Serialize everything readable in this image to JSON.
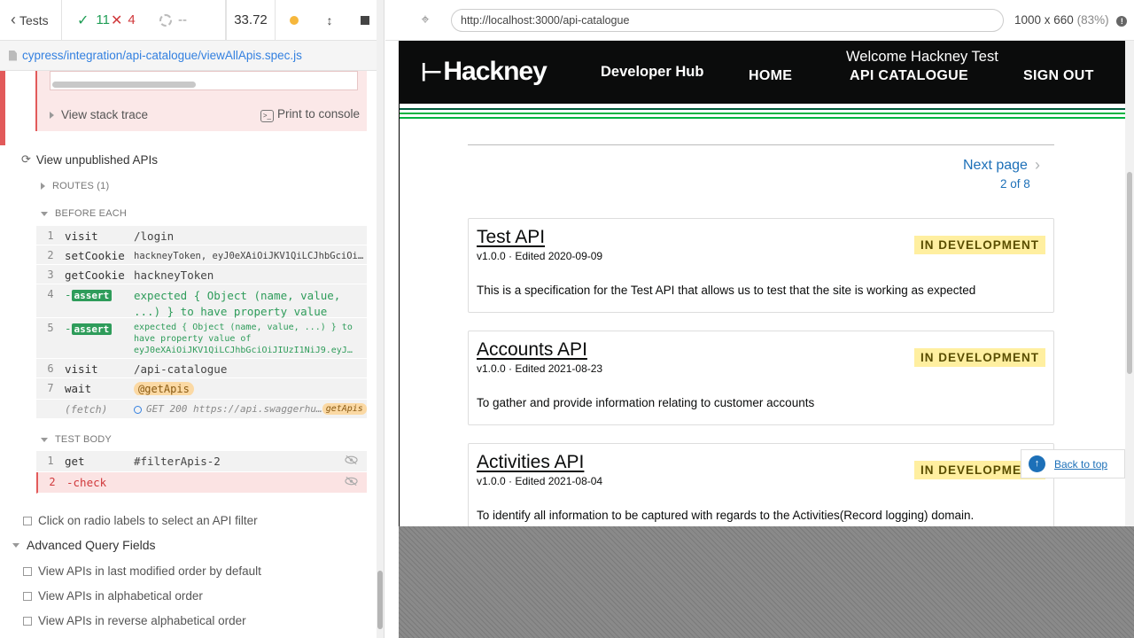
{
  "reporter": {
    "tests_label": "Tests",
    "passed": "11",
    "failed": "4",
    "pending": "--",
    "duration": "33.72",
    "spec_path": "cypress/integration/api-catalogue/viewAllApis.spec.js",
    "error_actions": {
      "stack_trace": "View stack trace",
      "print": "Print to console"
    },
    "current_test": "View unpublished APIs",
    "routes_label": "ROUTES (1)",
    "before_each_label": "BEFORE EACH",
    "before_each": [
      {
        "num": "1",
        "name": "visit",
        "msg": "/login"
      },
      {
        "num": "2",
        "name": "setCookie",
        "msg": "hackneyToken, eyJ0eXAiOiJKV1QiLCJhbGciOiJ…"
      },
      {
        "num": "3",
        "name": "getCookie",
        "msg": "hackneyToken"
      },
      {
        "num": "4",
        "name": "assert",
        "msg": "expected { Object (name, value, ...) } to have property value"
      },
      {
        "num": "5",
        "name": "assert",
        "msg": "expected { Object (name, value, ...) } to have property value of eyJ0eXAiOiJKV1QiLCJhbGciOiJIUzI1NiJ9.eyJ…"
      },
      {
        "num": "6",
        "name": "visit",
        "msg": "/api-catalogue"
      },
      {
        "num": "7",
        "name": "wait",
        "msg": "@getApis"
      },
      {
        "num": "",
        "name": "(fetch)",
        "msg": "GET 200 https://api.swaggerhu…",
        "alias": "getApis"
      }
    ],
    "test_body_label": "TEST BODY",
    "test_body": [
      {
        "num": "1",
        "name": "get",
        "msg": "#filterApis-2"
      },
      {
        "num": "2",
        "name": "check",
        "msg": ""
      }
    ],
    "tests": [
      "Click on radio labels to select an API filter",
      "View APIs in last modified order by default",
      "View APIs in alphabetical order",
      "View APIs in reverse alphabetical order"
    ],
    "suite": "Advanced Query Fields"
  },
  "browser": {
    "url": "http://localhost:3000/api-catalogue",
    "viewport": "1000 x 660",
    "scale": "(83%)"
  },
  "site": {
    "logo": "Hackney",
    "brand": "Developer Hub",
    "welcome": "Welcome Hackney Test",
    "nav": {
      "home": "HOME",
      "api": "API CATALOGUE",
      "signout": "SIGN OUT"
    },
    "pagination": {
      "next": "Next page",
      "pageof": "2 of 8"
    },
    "cards": [
      {
        "title": "Test API",
        "meta": "v1.0.0 · Edited 2020-09-09",
        "tag": "IN DEVELOPMENT",
        "desc": "This is a specification for the Test API that allows us to test that the site is working as expected"
      },
      {
        "title": "Accounts API",
        "meta": "v1.0.0 · Edited 2021-08-23",
        "tag": "IN DEVELOPMENT",
        "desc": "To gather and provide information relating to customer accounts"
      },
      {
        "title": "Activities API",
        "meta": "v1.0.0 · Edited 2021-08-04",
        "tag": "IN DEVELOPMENT",
        "desc": "To identify all information to be captured with regards to the Activities(Record logging) domain."
      }
    ],
    "back_to_top": "Back to top",
    "colors": {
      "header": "#0b0c0c",
      "stripe_dark": "#025e3e",
      "stripe_light": "#00b341",
      "link": "#1d70b8",
      "tag_bg": "#ffefa0"
    }
  }
}
